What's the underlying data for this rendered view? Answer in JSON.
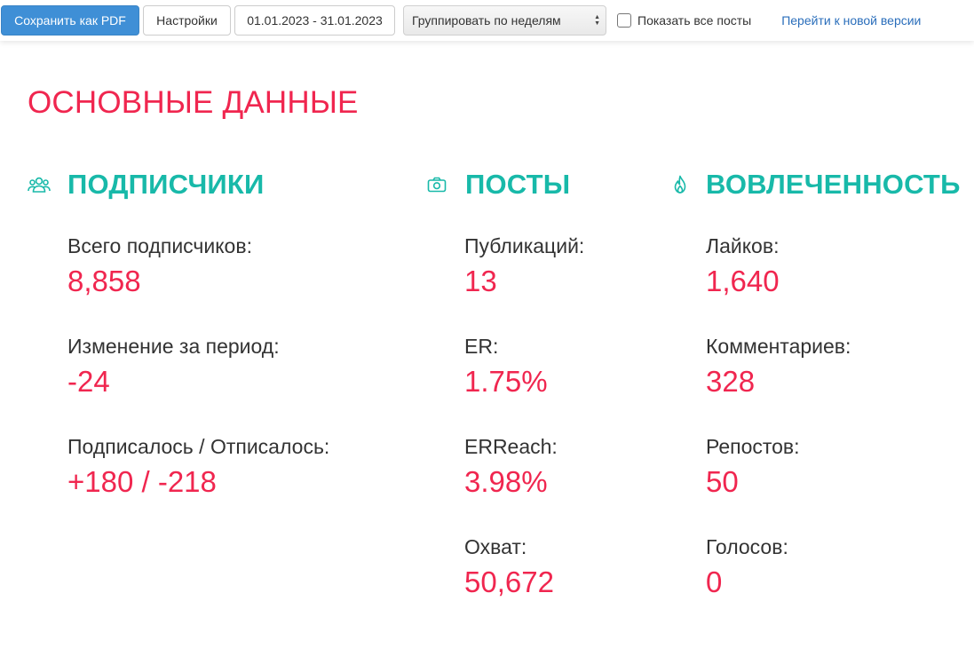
{
  "toolbar": {
    "save_pdf_label": "Сохранить как PDF",
    "settings_label": "Настройки",
    "date_range": "01.01.2023 - 31.01.2023",
    "group_by_selected": "Группировать по неделям",
    "show_all_posts_label": "Показать все посты",
    "show_all_posts_checked": false,
    "new_version_link": "Перейти к новой версии"
  },
  "main_title": "ОСНОВНЫЕ ДАННЫЕ",
  "sections": {
    "subscribers": {
      "title": "ПОДПИСЧИКИ",
      "icon": "users-icon",
      "metrics": [
        {
          "label": "Всего подписчиков:",
          "value": "8,858"
        },
        {
          "label": "Изменение за период:",
          "value": "-24"
        },
        {
          "label": "Подписалось / Отписалось:",
          "value": "+180 / -218"
        }
      ]
    },
    "posts": {
      "title": "ПОСТЫ",
      "icon": "camera-icon",
      "metrics": [
        {
          "label": "Публикаций:",
          "value": "13"
        },
        {
          "label": "ER:",
          "value": "1.75%"
        },
        {
          "label": "ERReach:",
          "value": "3.98%"
        },
        {
          "label": "Охват:",
          "value": "50,672"
        }
      ]
    },
    "engagement": {
      "title": "ВОВЛЕЧЕННОСТЬ",
      "icon": "flame-icon",
      "metrics": [
        {
          "label": "Лайков:",
          "value": "1,640"
        },
        {
          "label": "Комментариев:",
          "value": "328"
        },
        {
          "label": "Репостов:",
          "value": "50"
        },
        {
          "label": "Голосов:",
          "value": "0"
        }
      ]
    }
  },
  "colors": {
    "accent_red": "#f0264f",
    "accent_teal": "#18b9a9",
    "primary_blue": "#3f8fd6",
    "link_blue": "#2a6ebb"
  }
}
